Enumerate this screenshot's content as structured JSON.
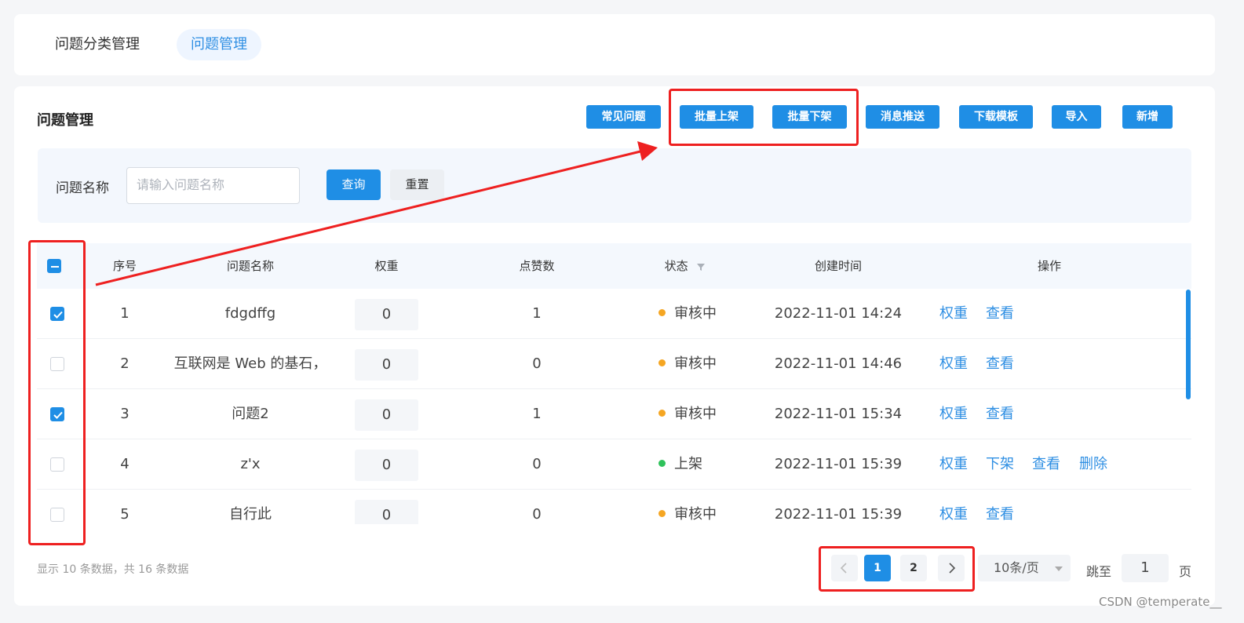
{
  "tabs": [
    {
      "label": "问题分类管理",
      "active": false
    },
    {
      "label": "问题管理",
      "active": true
    }
  ],
  "page_title": "问题管理",
  "toolbar": {
    "common_label": "常见问题",
    "batch_on_label": "批量上架",
    "batch_off_label": "批量下架",
    "push_label": "消息推送",
    "template_label": "下载模板",
    "import_label": "导入",
    "add_label": "新增"
  },
  "search": {
    "label": "问题名称",
    "placeholder": "请输入问题名称",
    "query_label": "查询",
    "reset_label": "重置"
  },
  "table": {
    "headers": {
      "index": "序号",
      "name": "问题名称",
      "weight": "权重",
      "likes": "点赞数",
      "status": "状态",
      "created": "创建时间",
      "actions": "操作"
    },
    "rows": [
      {
        "checked": true,
        "index": "1",
        "name": "fdgdffg",
        "weight": "0",
        "likes": "1",
        "status": "审核中",
        "status_color": "#f5a623",
        "created": "2022-11-01 14:24",
        "actions": [
          "权重",
          "查看"
        ]
      },
      {
        "checked": false,
        "index": "2",
        "name": "互联网是 Web 的基石，",
        "weight": "0",
        "likes": "0",
        "status": "审核中",
        "status_color": "#f5a623",
        "created": "2022-11-01 14:46",
        "actions": [
          "权重",
          "查看"
        ]
      },
      {
        "checked": true,
        "index": "3",
        "name": "问题2",
        "weight": "0",
        "likes": "1",
        "status": "审核中",
        "status_color": "#f5a623",
        "created": "2022-11-01 15:34",
        "actions": [
          "权重",
          "查看"
        ]
      },
      {
        "checked": false,
        "index": "4",
        "name": "z'x",
        "weight": "0",
        "likes": "0",
        "status": "上架",
        "status_color": "#2fc25b",
        "created": "2022-11-01 15:39",
        "actions": [
          "权重",
          "下架",
          "查看",
          "删除"
        ]
      },
      {
        "checked": false,
        "index": "5",
        "name": "自行此",
        "weight": "0",
        "likes": "0",
        "status": "审核中",
        "status_color": "#f5a623",
        "created": "2022-11-01 15:39",
        "actions": [
          "权重",
          "查看"
        ]
      }
    ]
  },
  "footer": {
    "info": "显示 10 条数据，共 16 条数据",
    "pages": [
      "1",
      "2"
    ],
    "current_page": "1",
    "page_size": "10条/页",
    "jump_label": "跳至",
    "jump_value": "1",
    "page_unit": "页"
  },
  "watermark": "CSDN @temperate__",
  "colors": {
    "accent": "#1f8ee5",
    "annotation": "#ee2020"
  }
}
